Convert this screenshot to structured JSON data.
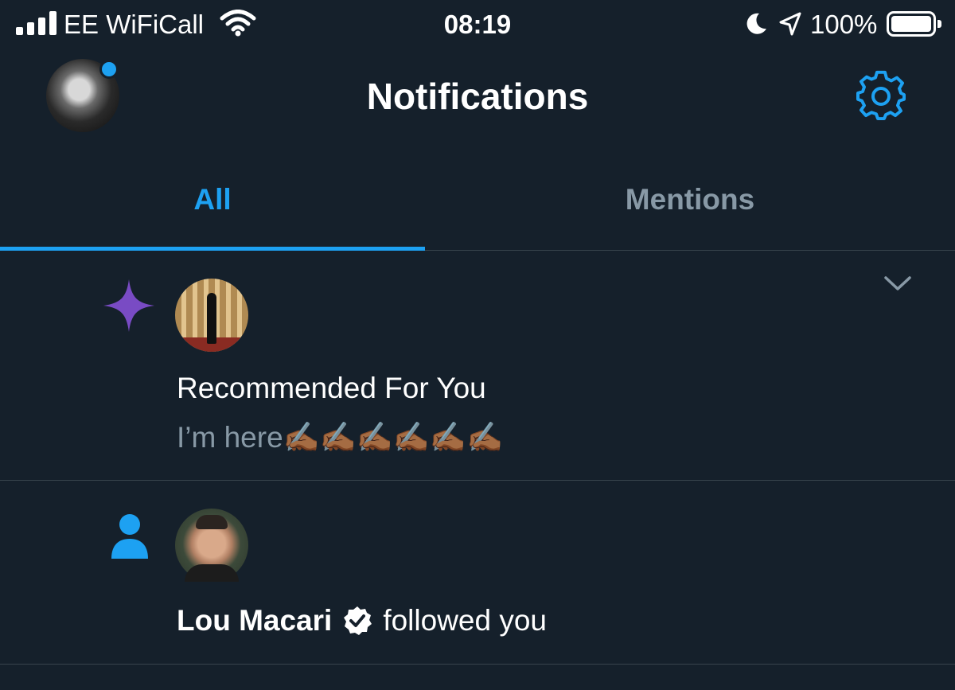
{
  "status_bar": {
    "carrier": "EE WiFiCall",
    "time": "08:19",
    "battery": "100%"
  },
  "header": {
    "title": "Notifications"
  },
  "tabs": [
    {
      "label": "All",
      "active": true
    },
    {
      "label": "Mentions",
      "active": false
    }
  ],
  "notifications": [
    {
      "icon": "sparkle-icon",
      "title": "Recommended For You",
      "text": "I’m here✍🏾✍🏾✍🏾✍🏾✍🏾✍🏾"
    },
    {
      "icon": "person-icon",
      "name": "Lou Macari",
      "verified": true,
      "action": "followed you"
    }
  ],
  "colors": {
    "background": "#15202b",
    "accent": "#1da1f2",
    "muted": "#8899a6",
    "sparkle": "#794bc4",
    "divider": "#38444d"
  }
}
